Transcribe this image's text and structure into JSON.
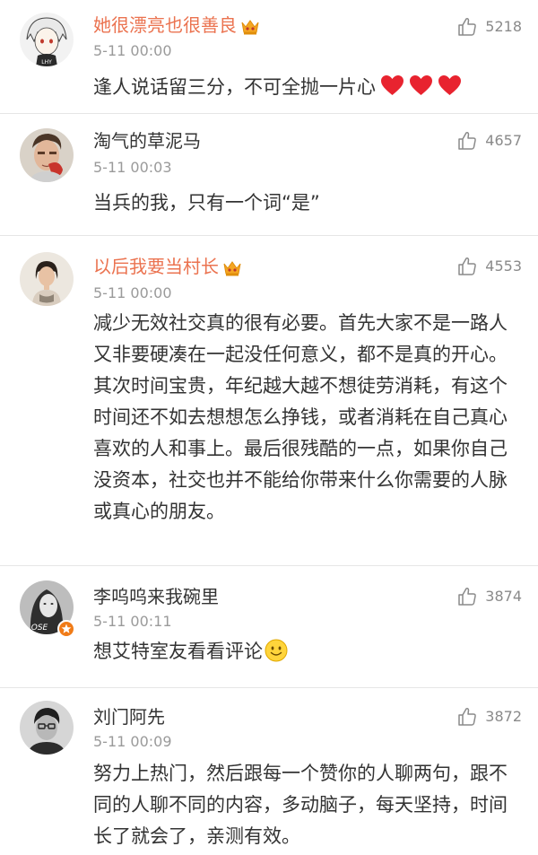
{
  "comments": [
    {
      "username": "她很漂亮也很善良",
      "time": "5-11 00:00",
      "likes": "5218",
      "text": "逢人说话留三分，不可全抛一片心",
      "avatar": "avatar-anime-boy",
      "avatar_caption": "LHY"
    },
    {
      "username": "淘气的草泥马",
      "time": "5-11 00:03",
      "likes": "4657",
      "text": "当兵的我，只有一个词“是”",
      "avatar": "avatar-man-photo"
    },
    {
      "username": "以后我要当村长",
      "time": "5-11 00:00",
      "likes": "4553",
      "text": "减少无效社交真的很有必要。首先大家不是一路人又非要硬凑在一起没任何意义，都不是真的开心。其次时间宝贵，年纪越大越不想徒劳消耗，有这个时间还不如去想想怎么挣钱，或者消耗在自己真心喜欢的人和事上。最后很残酷的一点，如果你自己没资本，社交也并不能给你带来什么你需要的人脉或真心的朋友。",
      "avatar": "avatar-woman-photo"
    },
    {
      "username": "李呜呜来我碗里",
      "time": "5-11 00:11",
      "likes": "3874",
      "text": "想艾特室友看看评论",
      "avatar": "avatar-woman-bw",
      "avatar_caption": "OSE"
    },
    {
      "username": "刘门阿先",
      "time": "5-11 00:09",
      "likes": "3872",
      "text": "努力上热门，然后跟每一个赞你的人聊两句，跟不同的人聊不同的内容，多动脑子，每天坚持，时间长了就会了，亲测有效。",
      "avatar": "avatar-man-bw"
    }
  ],
  "colors": {
    "vip_name": "#eb7350",
    "normal_name": "#333333",
    "meta": "#9a9a9a",
    "divider": "#e6e6e6",
    "heart": "#e8232f",
    "vip_badge": "#f07b17"
  },
  "icons": [
    "thumbs-up-icon",
    "crown-icon",
    "heart-icon",
    "smile-emoji-icon",
    "v-badge-icon"
  ]
}
